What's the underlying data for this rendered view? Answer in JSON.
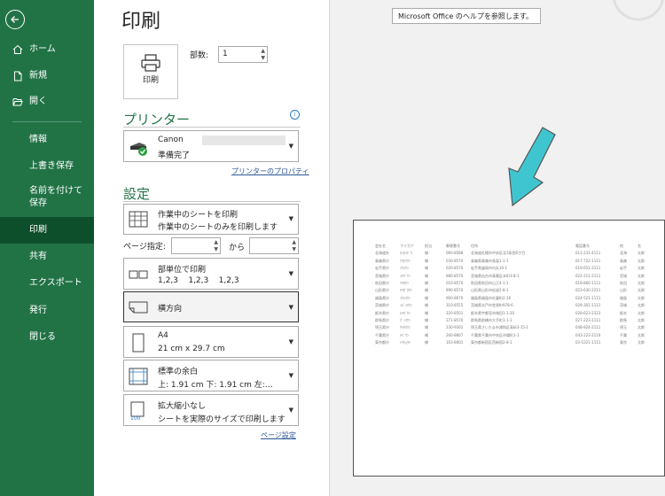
{
  "sidebar": {
    "items": [
      {
        "label": "ホーム",
        "icon": "home-icon"
      },
      {
        "label": "新規",
        "icon": "new-file-icon"
      },
      {
        "label": "開く",
        "icon": "folder-open-icon"
      },
      {
        "label": "情報"
      },
      {
        "label": "上書き保存"
      },
      {
        "label": "名前を付けて保存"
      },
      {
        "label": "印刷",
        "active": true
      },
      {
        "label": "共有"
      },
      {
        "label": "エクスポート"
      },
      {
        "label": "発行"
      },
      {
        "label": "閉じる"
      }
    ]
  },
  "main": {
    "title": "印刷",
    "print_button_label": "印刷",
    "copies_label": "部数:",
    "copies_value": "1",
    "printer_section": "プリンター",
    "printer_name": "Canon",
    "printer_status": "準備完了",
    "printer_properties_link": "プリンターのプロパティ",
    "settings_section": "設定",
    "settings": [
      {
        "line1": "作業中のシートを印刷",
        "line2": "作業中のシートのみを印刷します",
        "icon": "sheet-grid-icon"
      },
      {
        "line1": "部単位で印刷",
        "line2": "1,2,3    1,2,3    1,2,3",
        "icon": "collate-icon"
      },
      {
        "line1": "横方向",
        "line2": "",
        "icon": "landscape-page-icon"
      },
      {
        "line1": "A4",
        "line2": "21 cm x 29.7 cm",
        "icon": "page-size-icon"
      },
      {
        "line1": "標準の余白",
        "line2": "上: 1.91 cm 下: 1.91 cm 左:…",
        "icon": "margins-icon"
      },
      {
        "line1": "拡大縮小なし",
        "line2": "シートを実際のサイズで印刷します",
        "icon": "scale-100-icon"
      }
    ],
    "page_range_label": "ページ指定:",
    "page_range_to": "から",
    "page_setup_link": "ページ設定"
  },
  "tooltip": "Microsoft Office のヘルプを参照します。",
  "colors": {
    "accent": "#217346",
    "active": "#0e4f2b",
    "arrow": "#3fc5cf"
  },
  "preview_table": {
    "headers": [
      "会社名",
      "フリガナ",
      "担当",
      "郵便番号",
      "住所",
      "電話番号",
      "他",
      "名"
    ],
    "rows": [
      [
        "北海道外",
        "ﾎｯｶｲﾄﾞｳ",
        "様",
        "060-8588",
        "北海道札幌市中央区北3条西6丁目",
        "011-231-4111",
        "北海",
        "太郎"
      ],
      [
        "青森県庁",
        "ｱｵﾓﾘｹﾝ",
        "様",
        "030-8570",
        "青森県青森市長島1-1-1",
        "017-722-1111",
        "青森",
        "太郎"
      ],
      [
        "岩手県庁",
        "ｲﾜﾃｹﾝ",
        "様",
        "020-8570",
        "岩手県盛岡市内丸10-1",
        "019-651-3111",
        "岩手",
        "太郎"
      ],
      [
        "宮城県庁",
        "ﾐﾔｷﾞｹﾝ",
        "様",
        "980-8570",
        "宮城県仙台市青葉区本町3-8-1",
        "022-211-2111",
        "宮城",
        "太郎"
      ],
      [
        "秋田県庁",
        "ｱｷﾀｹﾝ",
        "様",
        "010-8570",
        "秋田県秋田市山王4-1-1",
        "018-860-1111",
        "秋田",
        "太郎"
      ],
      [
        "山形県庁",
        "ﾔﾏｶﾞﾀｹﾝ",
        "様",
        "990-8570",
        "山形県山形市松波2-8-1",
        "023-630-2211",
        "山形",
        "太郎"
      ],
      [
        "福島県庁",
        "ﾌｸｼﾏｹﾝ",
        "様",
        "960-8670",
        "福島県福島市杉妻町2-16",
        "024-521-1111",
        "福島",
        "太郎"
      ],
      [
        "茨城県庁",
        "ｲﾊﾞﾗｷｹﾝ",
        "様",
        "310-8555",
        "茨城県水戸市笠原町978-6",
        "029-301-1111",
        "茨城",
        "太郎"
      ],
      [
        "栃木県庁",
        "ﾄﾁｷﾞｹﾝ",
        "様",
        "320-8501",
        "栃木県宇都宮市塙田1-1-20",
        "028-623-2323",
        "栃木",
        "太郎"
      ],
      [
        "群馬県庁",
        "ｸﾞﾝﾏｹﾝ",
        "様",
        "371-8570",
        "群馬県前橋市大手町1-1-1",
        "027-223-1111",
        "群馬",
        "太郎"
      ],
      [
        "埼玉県庁",
        "ｻｲﾀﾏｹﾝ",
        "様",
        "330-9301",
        "埼玉県さいたま市浦和区高砂3-15-1",
        "048-824-2111",
        "埼玉",
        "太郎"
      ],
      [
        "千葉県庁",
        "ﾁﾊﾞｹﾝ",
        "様",
        "260-8667",
        "千葉県千葉市中央区市場町1-1",
        "043-223-2110",
        "千葉",
        "太郎"
      ],
      [
        "東京都庁",
        "ﾄｳｷｮｳﾄ",
        "様",
        "163-8001",
        "東京都新宿区西新宿2-8-1",
        "03-5321-1111",
        "東京",
        "太郎"
      ]
    ]
  }
}
